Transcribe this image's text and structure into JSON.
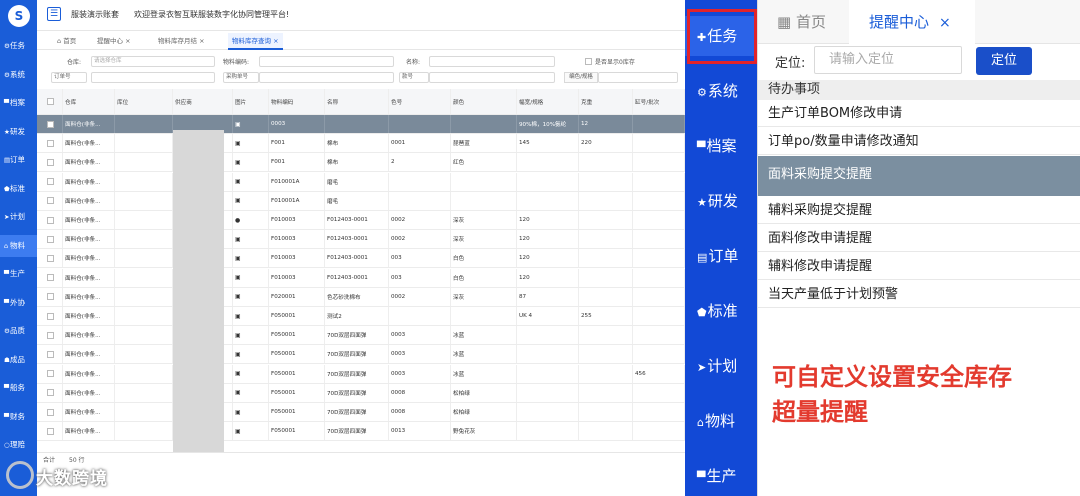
{
  "left": {
    "sidebar": [
      {
        "icon": "⚙",
        "label": "任务"
      },
      {
        "icon": "⚙",
        "label": "系统"
      },
      {
        "icon": "▀",
        "label": "档案"
      },
      {
        "icon": "★",
        "label": "研发"
      },
      {
        "icon": "▤",
        "label": "订单"
      },
      {
        "icon": "⬟",
        "label": "标准"
      },
      {
        "icon": "➤",
        "label": "计划"
      },
      {
        "icon": "⌂",
        "label": "物料"
      },
      {
        "icon": "▀",
        "label": "生产"
      },
      {
        "icon": "▀",
        "label": "外协"
      },
      {
        "icon": "⚙",
        "label": "品质"
      },
      {
        "icon": "☗",
        "label": "成品"
      },
      {
        "icon": "▀",
        "label": "船务"
      },
      {
        "icon": "▀",
        "label": "财务"
      },
      {
        "icon": "○",
        "label": "理赔"
      }
    ],
    "header": {
      "logo": "S",
      "menu_icon": "☰",
      "account": "服装演示账套",
      "welcome": "欢迎登录衣智互联服装数字化协同管理平台!"
    },
    "tabs": [
      {
        "label": "⌂ 首页"
      },
      {
        "label": "提醒中心 ×"
      },
      {
        "label": "物料库存月结 ×"
      },
      {
        "label": "物料库存查询 ×"
      }
    ],
    "filters": {
      "warehouse_label": "仓库:",
      "warehouse_placeholder": "请选择仓库",
      "material_code_label": "物料编码:",
      "name_label": "名称:",
      "show_zero_label": "是否显示0库存",
      "order_no_placeholder": "订单号",
      "purchase_no_placeholder": "采购单号",
      "color_no_placeholder": "款号",
      "spec_button": "编色/规格"
    },
    "columns": [
      "",
      "仓库",
      "库位",
      "供应商",
      "图片",
      "物料编码",
      "名称",
      "色号",
      "颜色",
      "幅宽/规格",
      "克重",
      "缸号/批次"
    ],
    "rows": [
      [
        "面料仓(非条...",
        "",
        "",
        "▣",
        "0003",
        "",
        "",
        "",
        "90%棉，10%氨纶",
        "12",
        ""
      ],
      [
        "面料仓(非条...",
        "",
        "",
        "▣",
        "F001",
        "棉布",
        "0001",
        "琵琶蓝",
        "145",
        "220",
        ""
      ],
      [
        "面料仓(非条...",
        "",
        "",
        "▣",
        "F001",
        "棉布",
        "2",
        "红色",
        "",
        "",
        ""
      ],
      [
        "面料仓(非条...",
        "",
        "",
        "▣",
        "F010001A",
        "磨毛",
        "",
        "",
        "",
        "",
        ""
      ],
      [
        "面料仓(非条...",
        "",
        "",
        "▣",
        "F010001A",
        "磨毛",
        "",
        "",
        "",
        "",
        ""
      ],
      [
        "面料仓(非条...",
        "",
        "",
        "●",
        "F010003",
        "F012403-0001",
        "0002",
        "深灰",
        "120",
        "",
        ""
      ],
      [
        "面料仓(非条...",
        "",
        "",
        "▣",
        "F010003",
        "F012403-0001",
        "0002",
        "深灰",
        "120",
        "",
        ""
      ],
      [
        "面料仓(非条...",
        "",
        "",
        "▣",
        "F010003",
        "F012403-0001",
        "003",
        "白色",
        "120",
        "",
        ""
      ],
      [
        "面料仓(非条...",
        "",
        "",
        "▣",
        "F010003",
        "F012403-0001",
        "003",
        "白色",
        "120",
        "",
        ""
      ],
      [
        "面料仓(非条...",
        "",
        "",
        "▣",
        "F020001",
        "色芯砂洗棉布",
        "0002",
        "深灰",
        "87",
        "",
        ""
      ],
      [
        "面料仓(非条...",
        "",
        "",
        "▣",
        "F050001",
        "测试2",
        "",
        "",
        "UK 4",
        "255",
        ""
      ],
      [
        "面料仓(非条...",
        "",
        "",
        "▣",
        "F050001",
        "70D双层四面弹",
        "0003",
        "冰蓝",
        "",
        "",
        ""
      ],
      [
        "面料仓(非条...",
        "",
        "",
        "▣",
        "F050001",
        "70D双层四面弹",
        "0003",
        "冰蓝",
        "",
        "",
        ""
      ],
      [
        "面料仓(非条...",
        "",
        "",
        "▣",
        "F050001",
        "70D双层四面弹",
        "0003",
        "冰蓝",
        "",
        "",
        "456"
      ],
      [
        "面料仓(非条...",
        "",
        "",
        "▣",
        "F050001",
        "70D双层四面弹",
        "0008",
        "松柏绿",
        "",
        "",
        ""
      ],
      [
        "面料仓(非条...",
        "",
        "",
        "▣",
        "F050001",
        "70D双层四面弹",
        "0008",
        "松柏绿",
        "",
        "",
        ""
      ],
      [
        "面料仓(非条...",
        "",
        "",
        "▣",
        "F050001",
        "70D双层四面弹",
        "0013",
        "野兔花灰",
        "",
        "",
        ""
      ]
    ],
    "footer": {
      "total_label": "合计",
      "total_count": "50 行"
    },
    "watermark": "大数跨境"
  },
  "right": {
    "sidebar": [
      {
        "icon": "✚",
        "label": "任务"
      },
      {
        "icon": "⚙",
        "label": "系统"
      },
      {
        "icon": "▀",
        "label": "档案"
      },
      {
        "icon": "★",
        "label": "研发"
      },
      {
        "icon": "▤",
        "label": "订单"
      },
      {
        "icon": "⬟",
        "label": "标准"
      },
      {
        "icon": "➤",
        "label": "计划"
      },
      {
        "icon": "⌂",
        "label": "物料"
      },
      {
        "icon": "▀",
        "label": "生产"
      }
    ],
    "tabs": [
      {
        "icon": "▦",
        "label": "首页"
      },
      {
        "label": "提醒中心",
        "close": "×"
      }
    ],
    "locate": {
      "label": "定位:",
      "placeholder": "请输入定位",
      "button": "定位"
    },
    "list_header": "待办事项",
    "list_items": [
      "生产订单BOM修改申请",
      "订单po/数量申请修改通知",
      "面料采购提交提醒",
      "辅料采购提交提醒",
      "面料修改申请提醒",
      "辅料修改申请提醒",
      "当天产量低于计划预警"
    ],
    "selected_index": 2,
    "note_line1": "可自定义设置安全库存",
    "note_line2": "超量提醒"
  },
  "colors": {
    "brand_blue": "#1a5dd8",
    "right_sidebar_blue": "#1249d6",
    "selected_row": "#7b8fa0",
    "note_red": "#e33a2e",
    "highlight_box": "#e1232a"
  }
}
